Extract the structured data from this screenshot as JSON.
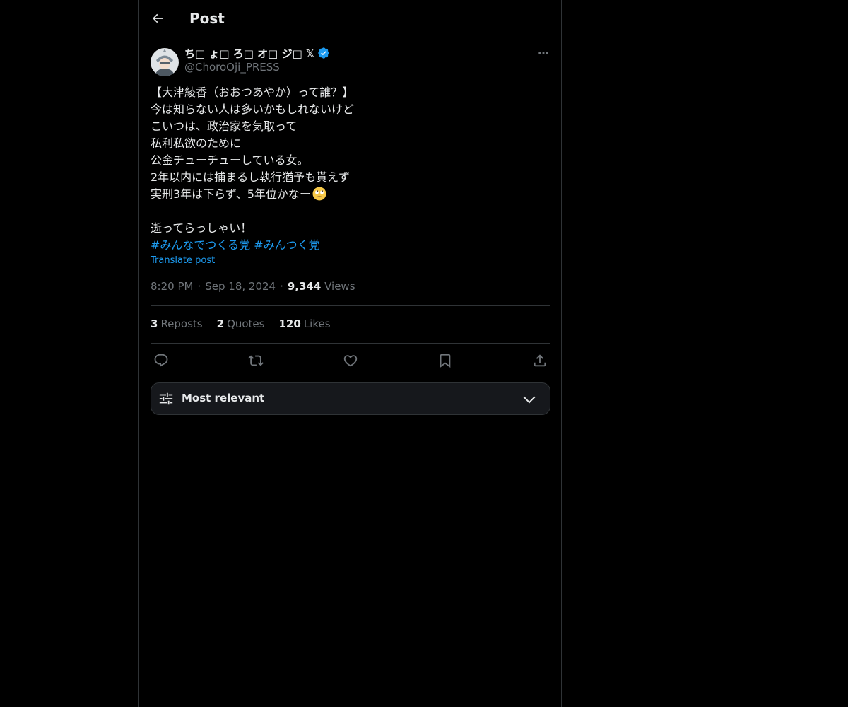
{
  "header": {
    "title": "Post",
    "back_icon": "arrow-left-icon"
  },
  "author": {
    "display_name": "ち□ ょ□ ろ□ オ□ ジ□ 𝕏",
    "handle": "@ChoroOji_PRESS",
    "verified_icon": "verified-badge-icon",
    "avatar_icon": "avatar",
    "more_icon": "more-icon"
  },
  "tweet": {
    "lines": [
      "【大津綾香（おおつあやか）って誰？】",
      "今は知らない人は多いかもしれないけど",
      "こいつは、政治家を気取って",
      "私利私欲のために",
      "公金チューチューしている女。",
      "2年以内には捕まるし執行猶予も貰えず",
      "実刑3年は下らず、5年位かなー",
      "",
      "逝ってらっしゃい！"
    ],
    "emoji": "face-with-rolling-eyes",
    "hashtags": [
      "#みんなでつくる党",
      "#みんつく党"
    ],
    "translate": "Translate post"
  },
  "meta": {
    "time": "8:20 PM",
    "date": "Sep 18, 2024",
    "separator": "·",
    "views_count": "9,344",
    "views_label": "Views"
  },
  "stats": {
    "reposts_count": "3",
    "reposts_label": "Reposts",
    "quotes_count": "2",
    "quotes_label": "Quotes",
    "likes_count": "120",
    "likes_label": "Likes"
  },
  "actions": [
    {
      "name": "reply",
      "icon": "reply-icon"
    },
    {
      "name": "repost",
      "icon": "repost-icon"
    },
    {
      "name": "like",
      "icon": "heart-icon"
    },
    {
      "name": "bookmark",
      "icon": "bookmark-icon"
    },
    {
      "name": "share",
      "icon": "share-icon"
    }
  ],
  "sort": {
    "label": "Most relevant",
    "icon": "filter-sliders-icon",
    "chevron": "chevron-down-icon"
  },
  "colors": {
    "background": "#000000",
    "text": "#e7e9ea",
    "muted": "#71767b",
    "accent": "#1d9bf0",
    "border": "#2f3336"
  }
}
